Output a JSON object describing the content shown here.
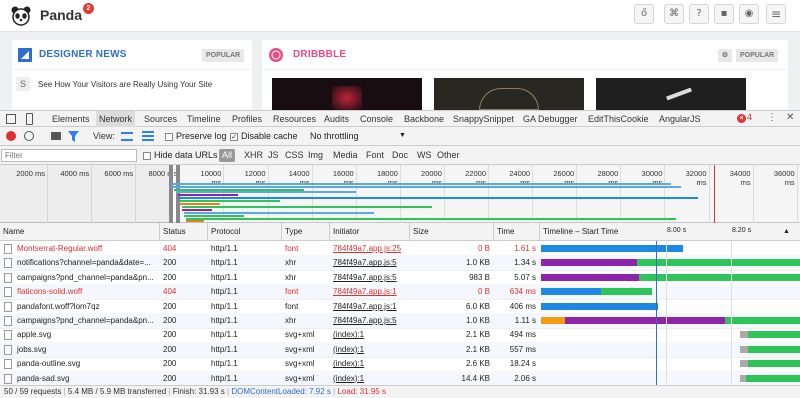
{
  "app": {
    "name": "Panda",
    "badge": "2",
    "designer_news": {
      "title": "DESIGNER NEWS",
      "badge": "POPULAR",
      "first_item": "See How Your Visitors are Really Using Your Site",
      "item_letter": "S",
      "color": "#2f6fcf"
    },
    "dribbble": {
      "title": "DRIBBBLE",
      "color": "#ea4c89"
    }
  },
  "devtools": {
    "tabs": [
      "Elements",
      "Network",
      "Sources",
      "Timeline",
      "Profiles",
      "Resources",
      "Audits",
      "Console",
      "Backbone",
      "SnappySnippet",
      "GA Debugger",
      "EditThisCookie",
      "AngularJS"
    ],
    "selected_tab": "Network",
    "error_count": "4",
    "toolbar": {
      "view_label": "View:",
      "preserve_log": "Preserve log",
      "disable_cache": "Disable cache",
      "throttling": "No throttling"
    },
    "filter": {
      "placeholder": "Filter",
      "hide_data_urls": "Hide data URLs",
      "types": [
        "All",
        "XHR",
        "JS",
        "CSS",
        "Img",
        "Media",
        "Font",
        "Doc",
        "WS",
        "Other"
      ],
      "selected_type": "All"
    },
    "overview_ticks": [
      "2000 ms",
      "4000 ms",
      "6000 ms",
      "8000 ms",
      "10000 ms",
      "12000 ms",
      "14000 ms",
      "16000 ms",
      "18000 ms",
      "20000 ms",
      "22000 ms",
      "24000 ms",
      "26000 ms",
      "28000 ms",
      "30000 ms",
      "32000 ms",
      "34000 ms",
      "36000 ms"
    ],
    "columns": [
      "Name",
      "Status",
      "Protocol",
      "Type",
      "Initiator",
      "Size",
      "Time",
      "Timeline – Start Time"
    ],
    "timeline_ticks": [
      "8.00 s",
      "8.20 s"
    ],
    "rows": [
      {
        "name": "Montserrat-Regular.woff",
        "status": "404",
        "protocol": "http/1.1",
        "type": "font",
        "initiator": "784f49a7.app.js:25",
        "size": "0 B",
        "time": "1.61 s",
        "error": true,
        "start": 0.0,
        "waiting": 0.0,
        "receive": 0.55
      },
      {
        "name": "notifications?channel=panda&date=...",
        "status": "200",
        "protocol": "http/1.1",
        "type": "xhr",
        "initiator": "784f49a7.app.js:5",
        "size": "1.0 KB",
        "time": "1.34 s",
        "error": false,
        "start": 0.0,
        "waiting": 0.37,
        "receive": 1.0
      },
      {
        "name": "campaigns?pnd_channel=panda&pn...",
        "status": "200",
        "protocol": "http/1.1",
        "type": "xhr",
        "initiator": "784f49a7.app.js:5",
        "size": "983 B",
        "time": "5.07 s",
        "error": false,
        "start": 0.0,
        "waiting": 0.38,
        "receive": 1.0
      },
      {
        "name": "flaticons-solid.woff",
        "status": "404",
        "protocol": "http/1.1",
        "type": "font",
        "initiator": "784f49a7.app.js:1",
        "size": "0 B",
        "time": "634 ms",
        "error": true,
        "start": 0.0,
        "waiting": 0.22,
        "receive": 0.43
      },
      {
        "name": "pandafont.woff?lom7qz",
        "status": "200",
        "protocol": "http/1.1",
        "type": "font",
        "initiator": "784f49a7.app.js:1",
        "size": "6.0 KB",
        "time": "406 ms",
        "error": false,
        "start": 0.0,
        "waiting": 0.22,
        "receive": 0.45
      },
      {
        "name": "campaigns?pnd_channel=panda&pn...",
        "status": "200",
        "protocol": "http/1.1",
        "type": "xhr",
        "initiator": "784f49a7.app.js:5",
        "size": "1.0 KB",
        "time": "1.11 s",
        "error": false,
        "start": 0.0,
        "waiting": 0.71,
        "receive": 1.0
      },
      {
        "name": "apple.svg",
        "status": "200",
        "protocol": "http/1.1",
        "type": "svg+xml",
        "initiator": "(index):1",
        "size": "2.1 KB",
        "time": "494 ms",
        "error": false,
        "start": 0.39,
        "waiting": 0.39,
        "receive": 1.0
      },
      {
        "name": "jobs.svg",
        "status": "200",
        "protocol": "http/1.1",
        "type": "svg+xml",
        "initiator": "(index):1",
        "size": "2.1 KB",
        "time": "557 ms",
        "error": false,
        "start": 0.39,
        "waiting": 0.39,
        "receive": 1.0
      },
      {
        "name": "panda-outline.svg",
        "status": "200",
        "protocol": "http/1.1",
        "type": "svg+xml",
        "initiator": "(index):1",
        "size": "2.6 KB",
        "time": "18.24 s",
        "error": false,
        "start": 0.39,
        "waiting": 0.39,
        "receive": 1.0
      },
      {
        "name": "panda-sad.svg",
        "status": "200",
        "protocol": "http/1.1",
        "type": "svg+xml",
        "initiator": "(index):1",
        "size": "14.4 KB",
        "time": "2.06 s",
        "error": false,
        "start": 0.39,
        "waiting": 0.39,
        "receive": 1.0
      }
    ],
    "status": {
      "requests": "50 / 59 requests",
      "transferred": "5.4 MB / 5.9 MB transferred",
      "finish": "Finish: 31.93 s",
      "dcl": "DOMContentLoaded: 7.92 s",
      "load": "Load: 31.95 s"
    },
    "colors": {
      "receive": "#1e88e5",
      "waiting": "#8e24aa",
      "xhr_receive": "#2fc45a",
      "dcl": "#2f6fcf",
      "load": "#e03030",
      "error": "#e03030"
    }
  }
}
